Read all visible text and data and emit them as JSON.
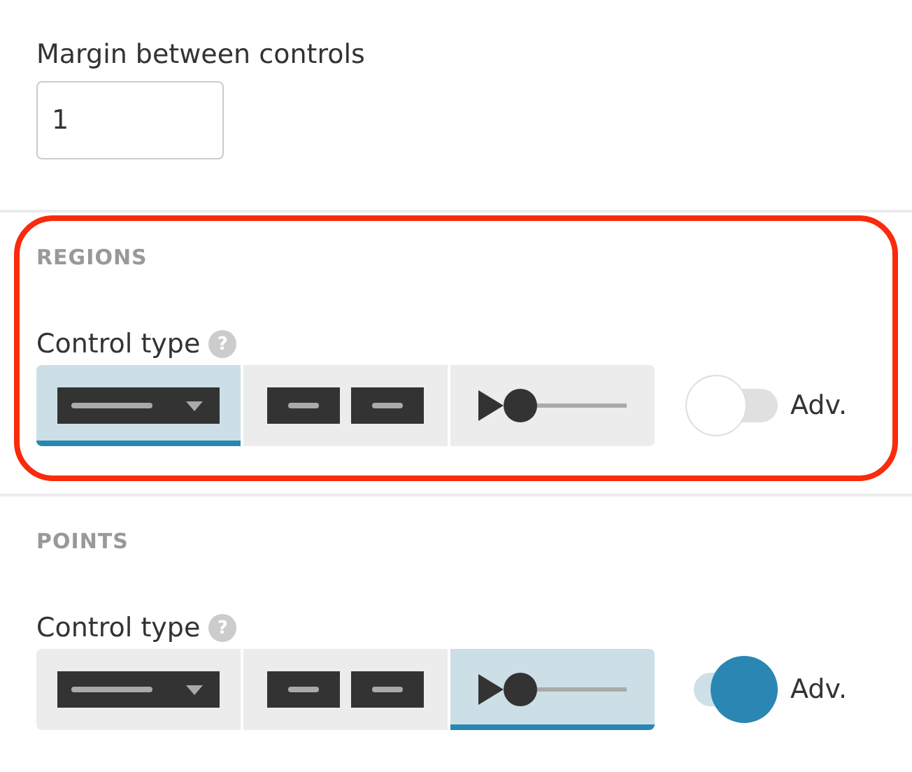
{
  "margin_field": {
    "label": "Margin between controls",
    "value": "1"
  },
  "sections": [
    {
      "title": "REGIONS",
      "highlighted": true,
      "label": "Control type",
      "help": "?",
      "options": [
        {
          "kind": "dropdown",
          "selected": true
        },
        {
          "kind": "buttons",
          "selected": false
        },
        {
          "kind": "slider",
          "selected": false
        }
      ],
      "toggle": {
        "label": "Adv.",
        "on": false
      }
    },
    {
      "title": "POINTS",
      "highlighted": false,
      "label": "Control type",
      "help": "?",
      "options": [
        {
          "kind": "dropdown",
          "selected": false
        },
        {
          "kind": "buttons",
          "selected": false
        },
        {
          "kind": "slider",
          "selected": true
        }
      ],
      "toggle": {
        "label": "Adv.",
        "on": true
      }
    }
  ]
}
